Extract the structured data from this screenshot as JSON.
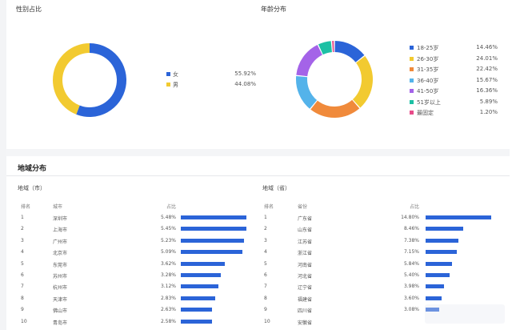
{
  "gender": {
    "title": "性别占比",
    "items": [
      {
        "label": "女",
        "value": "55.92%",
        "color": "#2b64d8"
      },
      {
        "label": "男",
        "value": "44.08%",
        "color": "#f2ca30"
      }
    ]
  },
  "age": {
    "title": "年龄分布",
    "items": [
      {
        "label": "18-25岁",
        "value": "14.46%",
        "color": "#2b64d8"
      },
      {
        "label": "26-30岁",
        "value": "24.01%",
        "color": "#f2ca30"
      },
      {
        "label": "31-35岁",
        "value": "22.42%",
        "color": "#f08a3b"
      },
      {
        "label": "36-40岁",
        "value": "15.67%",
        "color": "#54b3ea"
      },
      {
        "label": "41-50岁",
        "value": "16.36%",
        "color": "#a463e8"
      },
      {
        "label": "51岁以上",
        "value": "5.89%",
        "color": "#1cc0a4"
      },
      {
        "label": "最固定",
        "value": "1.20%",
        "color": "#e74c8a"
      }
    ]
  },
  "region": {
    "title": "地域分布",
    "city": {
      "subtitle": "地域（市）",
      "headers": {
        "rank": "排名",
        "name": "城市",
        "pct": "占比"
      },
      "rows": [
        {
          "rank": "1",
          "name": "深圳市",
          "pct": "5.48%",
          "ratio": 0.98
        },
        {
          "rank": "2",
          "name": "上海市",
          "pct": "5.45%",
          "ratio": 0.98
        },
        {
          "rank": "3",
          "name": "广州市",
          "pct": "5.23%",
          "ratio": 0.94
        },
        {
          "rank": "4",
          "name": "北京市",
          "pct": "5.09%",
          "ratio": 0.92
        },
        {
          "rank": "5",
          "name": "东莞市",
          "pct": "3.62%",
          "ratio": 0.65
        },
        {
          "rank": "6",
          "name": "苏州市",
          "pct": "3.28%",
          "ratio": 0.59
        },
        {
          "rank": "7",
          "name": "杭州市",
          "pct": "3.12%",
          "ratio": 0.56
        },
        {
          "rank": "8",
          "name": "天津市",
          "pct": "2.83%",
          "ratio": 0.51
        },
        {
          "rank": "9",
          "name": "佛山市",
          "pct": "2.63%",
          "ratio": 0.47
        },
        {
          "rank": "10",
          "name": "青岛市",
          "pct": "2.58%",
          "ratio": 0.46
        }
      ]
    },
    "province": {
      "subtitle": "地域（省）",
      "headers": {
        "rank": "排名",
        "name": "省份",
        "pct": "占比"
      },
      "rows": [
        {
          "rank": "1",
          "name": "广东省",
          "pct": "14.80%",
          "ratio": 0.98
        },
        {
          "rank": "2",
          "name": "山东省",
          "pct": "8.46%",
          "ratio": 0.56
        },
        {
          "rank": "3",
          "name": "江苏省",
          "pct": "7.38%",
          "ratio": 0.49
        },
        {
          "rank": "4",
          "name": "浙江省",
          "pct": "7.15%",
          "ratio": 0.47
        },
        {
          "rank": "5",
          "name": "河南省",
          "pct": "5.84%",
          "ratio": 0.39
        },
        {
          "rank": "6",
          "name": "河北省",
          "pct": "5.40%",
          "ratio": 0.36
        },
        {
          "rank": "7",
          "name": "辽宁省",
          "pct": "3.98%",
          "ratio": 0.27
        },
        {
          "rank": "8",
          "name": "福建省",
          "pct": "3.60%",
          "ratio": 0.24
        },
        {
          "rank": "9",
          "name": "四川省",
          "pct": "3.08%",
          "ratio": 0.2
        },
        {
          "rank": "10",
          "name": "安徽省",
          "pct": "",
          "ratio": 0
        }
      ]
    }
  }
}
